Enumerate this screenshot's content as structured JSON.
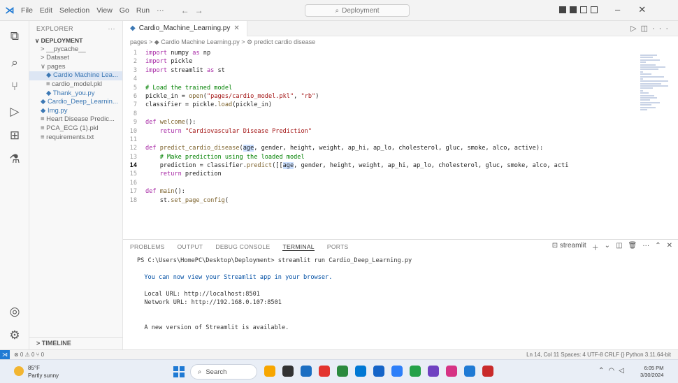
{
  "titlebar": {
    "menu": [
      "File",
      "Edit",
      "Selection",
      "View",
      "Go",
      "Run",
      "···"
    ],
    "search": "Deployment"
  },
  "explorer": {
    "header": "EXPLORER",
    "more": "···",
    "items": [
      {
        "label": "∨ DEPLOYMENT",
        "indent": 0,
        "bold": true
      },
      {
        "label": "> __pycache__",
        "indent": 1
      },
      {
        "label": "> Dataset",
        "indent": 1
      },
      {
        "label": "∨ pages",
        "indent": 1
      },
      {
        "label": "◆ Cardio Machine Lea...",
        "indent": 2,
        "py": true,
        "selected": true
      },
      {
        "label": "≡ cardio_model.pkl",
        "indent": 2
      },
      {
        "label": "◆ Thank_you.py",
        "indent": 2,
        "py": true
      },
      {
        "label": "◆ Cardio_Deep_Learnin...",
        "indent": 1,
        "py": true
      },
      {
        "label": "◆ Img.py",
        "indent": 1,
        "py": true
      },
      {
        "label": "≡ Heart Disease Predic...",
        "indent": 1
      },
      {
        "label": "≡ PCA_ECG (1).pkl",
        "indent": 1
      },
      {
        "label": "≡ requirements.txt",
        "indent": 1
      }
    ],
    "timeline": "> TIMELINE"
  },
  "editor": {
    "tab": "Cardio_Machine_Learning.py",
    "breadcrumb": "pages > ◆ Cardio Machine Learning.py > ⚙ predict cardio disease",
    "current_line": 14,
    "lines": [
      [
        [
          "kw",
          "import"
        ],
        [
          "src",
          " numpy "
        ],
        [
          "kw",
          "as"
        ],
        [
          "src",
          " np"
        ]
      ],
      [
        [
          "kw",
          "import"
        ],
        [
          "src",
          " pickle"
        ]
      ],
      [
        [
          "kw",
          "import"
        ],
        [
          "src",
          " streamlit "
        ],
        [
          "kw",
          "as"
        ],
        [
          "src",
          " st"
        ]
      ],
      [],
      [
        [
          "cm",
          "# Load the trained model"
        ]
      ],
      [
        [
          "src",
          "pickle_in = "
        ],
        [
          "fn",
          "open"
        ],
        [
          "src",
          "("
        ],
        [
          "str",
          "\"pages/cardio_model.pkl\""
        ],
        [
          "src",
          ", "
        ],
        [
          "str",
          "\"rb\""
        ],
        [
          "src",
          ")"
        ]
      ],
      [
        [
          "src",
          "classifier = pickle."
        ],
        [
          "fn",
          "load"
        ],
        [
          "src",
          "(pickle_in)"
        ]
      ],
      [],
      [
        [
          "kw",
          "def"
        ],
        [
          "src",
          " "
        ],
        [
          "fn",
          "welcome"
        ],
        [
          "src",
          "():"
        ]
      ],
      [
        [
          "src",
          "    "
        ],
        [
          "kw",
          "return"
        ],
        [
          "src",
          " "
        ],
        [
          "str",
          "\"Cardiovascular Disease Prediction\""
        ]
      ],
      [],
      [
        [
          "kw",
          "def"
        ],
        [
          "src",
          " "
        ],
        [
          "fn",
          "predict_cardio_disease"
        ],
        [
          "src",
          "("
        ],
        [
          "hl",
          "age"
        ],
        [
          "src",
          ", gender, height, weight, ap_hi, ap_lo, cholesterol, gluc, smoke, alco, active):"
        ]
      ],
      [
        [
          "src",
          "    "
        ],
        [
          "cm",
          "# Make prediction using the loaded model"
        ]
      ],
      [
        [
          "src",
          "    prediction = classifier."
        ],
        [
          "fn",
          "predict"
        ],
        [
          "src",
          "([["
        ],
        [
          "hl",
          "age"
        ],
        [
          "src",
          ", gender, height, weight, ap_hi, ap_lo, cholesterol, gluc, smoke, alco, acti"
        ]
      ],
      [
        [
          "src",
          "    "
        ],
        [
          "kw",
          "return"
        ],
        [
          "src",
          " prediction"
        ]
      ],
      [],
      [
        [
          "kw",
          "def"
        ],
        [
          "src",
          " "
        ],
        [
          "fn",
          "main"
        ],
        [
          "src",
          "():"
        ]
      ],
      [
        [
          "src",
          "    st."
        ],
        [
          "fn",
          "set_page_config"
        ],
        [
          "src",
          "("
        ]
      ]
    ]
  },
  "panel": {
    "tabs": [
      "PROBLEMS",
      "OUTPUT",
      "DEBUG CONSOLE",
      "TERMINAL",
      "PORTS"
    ],
    "active_tab": "TERMINAL",
    "shell": "streamlit",
    "terminal": [
      {
        "text": "PS C:\\Users\\HomePC\\Desktop\\Deployment> streamlit run Cardio_Deep_Learning.py",
        "cls": ""
      },
      {
        "text": "",
        "cls": ""
      },
      {
        "text": "  You can now view your Streamlit app in your browser.",
        "cls": "blue"
      },
      {
        "text": "",
        "cls": ""
      },
      {
        "text": "  Local URL: http://localhost:8501",
        "cls": ""
      },
      {
        "text": "  Network URL: http://192.168.0.107:8501",
        "cls": ""
      },
      {
        "text": "",
        "cls": ""
      },
      {
        "text": "",
        "cls": ""
      },
      {
        "text": "  A new version of Streamlit is available.",
        "cls": ""
      }
    ]
  },
  "statusbar": {
    "left": "⊗ 0 ⚠ 0   ⑂ 0",
    "right": "Ln 14, Col 11   Spaces: 4   UTF-8   CRLF   {} Python   3.11.64-bit"
  },
  "taskbar": {
    "weather_temp": "85°F",
    "weather_desc": "Partly sunny",
    "search": "Search",
    "time": "6:05 PM",
    "date": "3/30/2024",
    "apps": [
      "#f7a600",
      "#333333",
      "#1b6ec2",
      "#e3342f",
      "#2b8a3e",
      "#0078d4",
      "#1464c8",
      "#2d7ff9",
      "#24a148",
      "#6f42c1",
      "#d63384",
      "#1f7ad4",
      "#c92a2a"
    ]
  }
}
